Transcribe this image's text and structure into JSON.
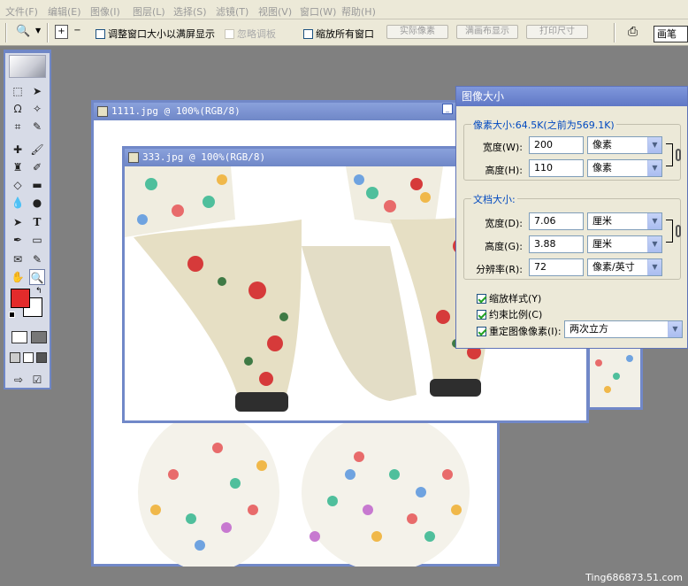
{
  "menu": [
    "文件(F)",
    "编辑(E)",
    "图像(I)",
    "图层(L)",
    "选择(S)",
    "滤镜(T)",
    "视图(V)",
    "窗口(W)",
    "帮助(H)"
  ],
  "options": {
    "fit_window": "调整窗口大小以满屏显示",
    "ignore_palettes": "忽略调板",
    "zoom_all": "缩放所有窗口",
    "actual_pixels": "实际像素",
    "fit_screen": "满画布显示",
    "print_size": "打印尺寸",
    "brush_tab": "画笔"
  },
  "windows": {
    "back_title": "1111.jpg @ 100%(RGB/8)",
    "front_title": "333.jpg @ 100%(RGB/8)"
  },
  "dialog": {
    "title": "图像大小",
    "pixel_dims": "像素大小:64.5K(之前为569.1K)",
    "width_label": "宽度(W):",
    "width_value": "200",
    "width_unit": "像素",
    "height_label": "高度(H):",
    "height_value": "110",
    "height_unit": "像素",
    "doc_size": "文档大小:",
    "doc_width_label": "宽度(D):",
    "doc_width_value": "7.06",
    "doc_width_unit": "厘米",
    "doc_height_label": "高度(G):",
    "doc_height_value": "3.88",
    "doc_height_unit": "厘米",
    "resolution_label": "分辨率(R):",
    "resolution_value": "72",
    "resolution_unit": "像素/英寸",
    "scale_styles": "缩放样式(Y)",
    "constrain": "约束比例(C)",
    "resample": "重定图像像素(I):",
    "resample_method": "两次立方"
  },
  "colors": {
    "foreground": "#e32b2b",
    "background": "#ffffff",
    "title_blue": "#6f87c7"
  },
  "watermark": "Ting686873.51.com"
}
